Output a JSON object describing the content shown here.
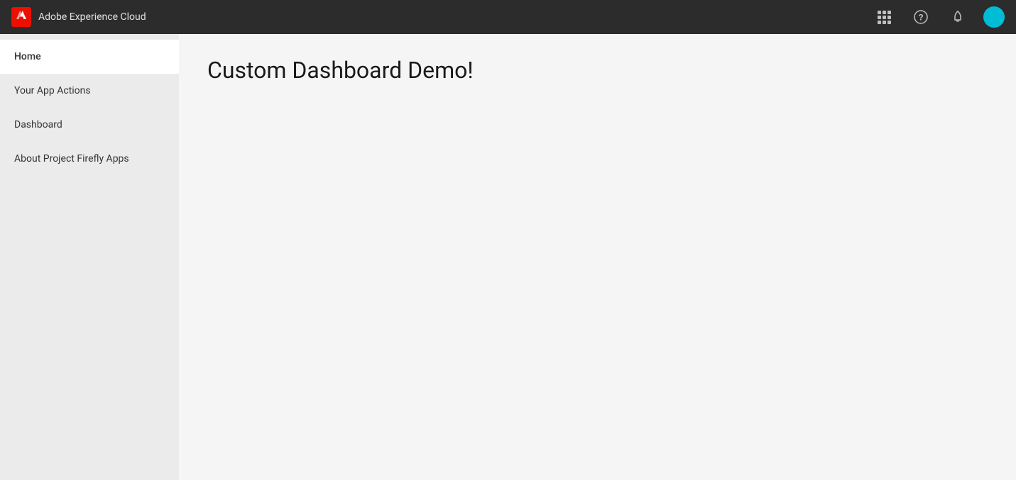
{
  "topbar": {
    "brand_name": "Adobe Experience Cloud",
    "adobe_logo_text": "Ai",
    "icons": {
      "grid": "grid-icon",
      "help": "help-icon",
      "notification": "notification-icon",
      "avatar": "avatar-icon"
    }
  },
  "sidebar": {
    "items": [
      {
        "id": "home",
        "label": "Home",
        "active": true
      },
      {
        "id": "your-app-actions",
        "label": "Your App Actions",
        "active": false
      },
      {
        "id": "dashboard",
        "label": "Dashboard",
        "active": false
      },
      {
        "id": "about",
        "label": "About Project Firefly Apps",
        "active": false
      }
    ]
  },
  "content": {
    "title": "Custom Dashboard Demo!"
  }
}
